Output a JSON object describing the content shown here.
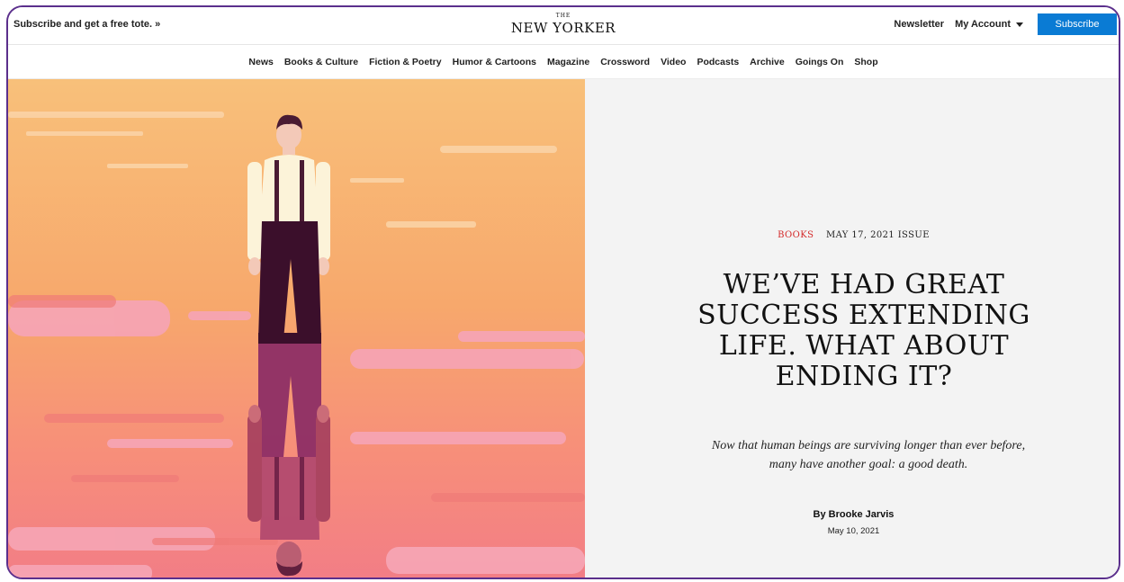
{
  "topbar": {
    "promo": "Subscribe and get a free tote. »",
    "logo_the": "THE",
    "logo_name": "NEW YORKER",
    "newsletter": "Newsletter",
    "account": "My Account",
    "subscribe": "Subscribe"
  },
  "nav": {
    "items": [
      "News",
      "Books & Culture",
      "Fiction & Poetry",
      "Humor & Cartoons",
      "Magazine",
      "Crossword",
      "Video",
      "Podcasts",
      "Archive",
      "Goings On",
      "Shop"
    ]
  },
  "article": {
    "rubric": "BOOKS",
    "issue": "MAY 17, 2021 ISSUE",
    "headline": "WE’VE HAD GREAT SUCCESS EXTENDING LIFE. WHAT ABOUT ENDING IT?",
    "dek": "Now that human beings are surviving longer than ever before, many have another goal: a good death.",
    "byline": "By Brooke Jarvis",
    "date": "May 10, 2021"
  },
  "colors": {
    "accent": "#0a7bd4",
    "rubric": "#d42a2a",
    "frame": "#5b2f8c",
    "panel_bg": "#f3f3f3"
  }
}
